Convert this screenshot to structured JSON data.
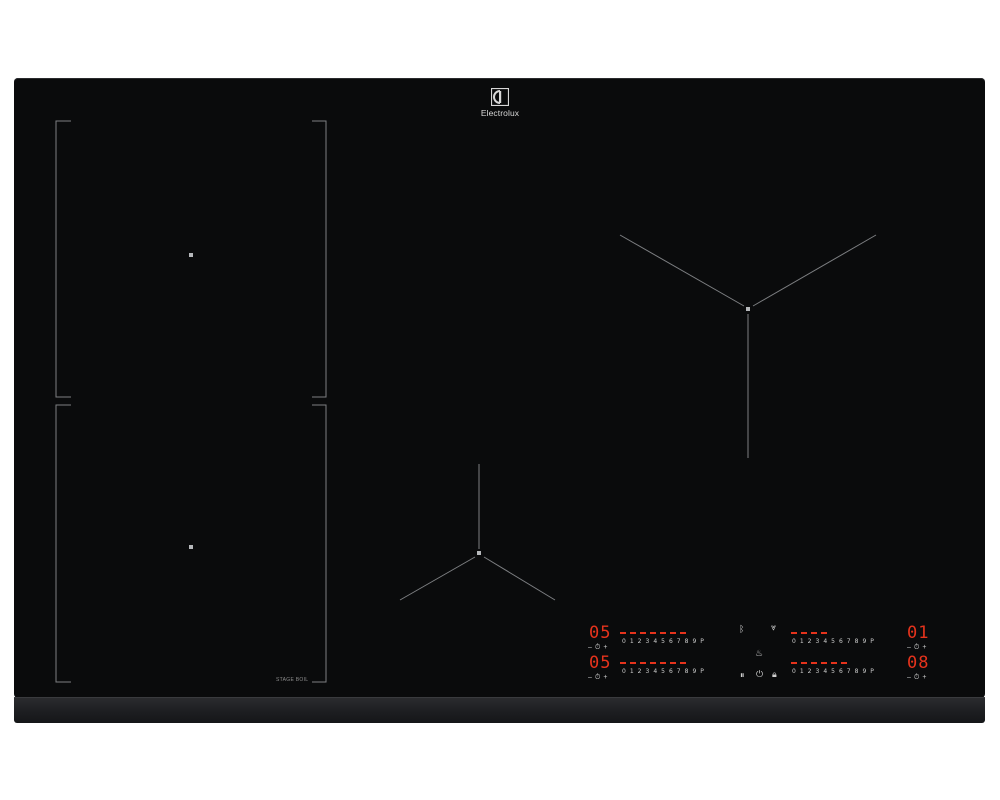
{
  "brand": {
    "name": "Electrolux"
  },
  "zone_label": "STAGE BOIL",
  "colors": {
    "glass": "#0a0b0c",
    "display": "#e5331c",
    "marking": "#8a8a8a"
  },
  "controls": [
    {
      "id": "front-left",
      "value": "05",
      "scale": [
        "0",
        "1",
        "2",
        "3",
        "4",
        "5",
        "6",
        "7",
        "8",
        "9",
        "P"
      ]
    },
    {
      "id": "rear-left",
      "value": "05",
      "scale": [
        "0",
        "1",
        "2",
        "3",
        "4",
        "5",
        "6",
        "7",
        "8",
        "9",
        "P"
      ]
    },
    {
      "id": "front-right",
      "value": "01",
      "scale": [
        "0",
        "1",
        "2",
        "3",
        "4",
        "5",
        "6",
        "7",
        "8",
        "9",
        "P"
      ]
    },
    {
      "id": "rear-right",
      "value": "08",
      "scale": [
        "0",
        "1",
        "2",
        "3",
        "4",
        "5",
        "6",
        "7",
        "8",
        "9",
        "P"
      ]
    }
  ],
  "timer_controls": {
    "minus": "–",
    "timer_icon": "⏱",
    "plus": "+"
  },
  "icons": [
    "hob2hood-icon",
    "steam-icon",
    "boost-icon",
    "pause-icon",
    "power-icon",
    "lock-icon"
  ]
}
